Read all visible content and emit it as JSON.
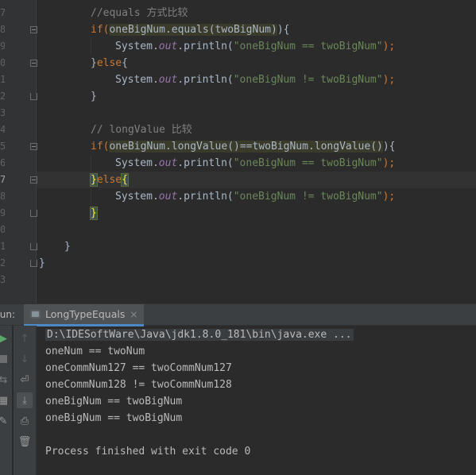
{
  "editor": {
    "line_numbers": [
      "7",
      "8",
      "9",
      "0",
      "1",
      "2",
      "3",
      "4",
      "5",
      "6",
      "7",
      "8",
      "9",
      "0",
      "1",
      "2",
      "3"
    ],
    "code": {
      "l1_comment": "//equals 方式比较",
      "l2_if": "if(",
      "l2_cond": "oneBigNum.equals(twoBigNum)",
      "l2_end": "){",
      "l3_pre": "System.",
      "l3_out": "out",
      "l3_mid": ".println(",
      "l3_str": "\"oneBigNum == twoBigNum\"",
      "l3_end": ");",
      "l4_brace": "}",
      "l4_else": "else",
      "l4_open": "{",
      "l5_pre": "System.",
      "l5_out": "out",
      "l5_mid": ".println(",
      "l5_str": "\"oneBigNum != twoBigNum\"",
      "l5_end": ");",
      "l6": "}",
      "l8_comment": "// longValue 比较",
      "l9_if": "if(",
      "l9_cond": "oneBigNum.longValue()==twoBigNum.longValue()",
      "l9_end": "){",
      "l10_pre": "System.",
      "l10_out": "out",
      "l10_mid": ".println(",
      "l10_str": "\"oneBigNum == twoBigNum\"",
      "l10_end": ");",
      "l11_brace": "}",
      "l11_else": "else",
      "l11_open": "{",
      "l12_pre": "System.",
      "l12_out": "out",
      "l12_mid": ".println(",
      "l12_str": "\"oneBigNum != twoBigNum\"",
      "l12_end": ");",
      "l13": "}",
      "l15": "}",
      "l16": "}"
    }
  },
  "run_panel": {
    "label": "Run:",
    "tab_label": "LongTypeEquals",
    "tab_close": "×",
    "console_lines": [
      "D:\\IDESoftWare\\Java\\jdk1.8.0_181\\bin\\java.exe ...",
      "oneNum == twoNum",
      "oneCommNum127 == twoCommNum127",
      "oneCommNum128 != twoCommNum128",
      "oneBigNum == twoBigNum",
      "oneBigNum == twoBigNum",
      "",
      "Process finished with exit code 0"
    ]
  },
  "icons": {
    "rerun": "play-icon",
    "stop": "stop-icon",
    "up": "arrow-up-icon",
    "down": "arrow-down-icon",
    "wrap": "soft-wrap-icon",
    "scroll_end": "scroll-to-end-icon",
    "print": "print-icon",
    "trash": "trash-icon"
  },
  "colors": {
    "keyword": "#cc7832",
    "string": "#6a8759",
    "comment": "#808080",
    "field": "#9876aa",
    "text": "#a9b7c6",
    "tab_accent": "#4a88c7"
  }
}
